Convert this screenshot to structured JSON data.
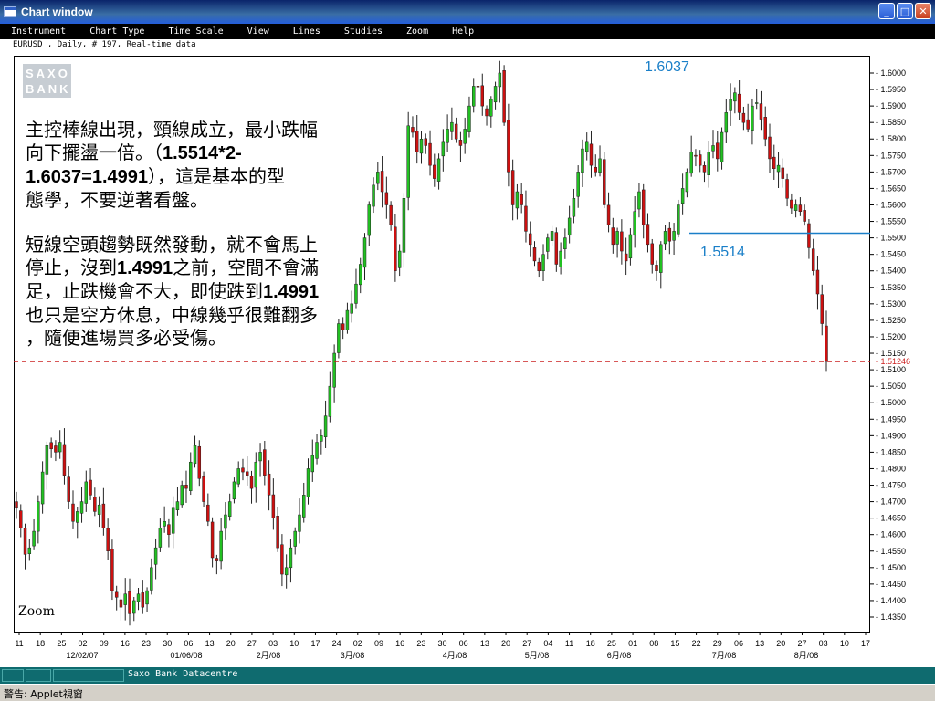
{
  "window": {
    "title": "Chart window",
    "minimize": "_",
    "maximize": "□",
    "close": "✕"
  },
  "menu": [
    "Instrument",
    "Chart Type",
    "Time Scale",
    "View",
    "Lines",
    "Studies",
    "Zoom",
    "Help"
  ],
  "subheader": "EURUSD , Daily, # 197, Real-time data",
  "logo": {
    "line1": "SAXO",
    "line2": "BANK"
  },
  "annotation": {
    "paragraph1": [
      "主控棒線出現，頸線成立，最小跌幅",
      "向下擺盪一倍。（",
      "1.5514*2-",
      "1.6037=1.4991",
      "），這是基本的型",
      "態學，不要逆著看盤。"
    ],
    "paragraph2": [
      "短線空頭趨勢既然發動，就不會馬上",
      "停止，沒到",
      "1.4991",
      "之前，空間不會滿",
      "足，止跌機會不大，即使跌到",
      "1.4991",
      "也只是空方休息，中線幾乎很難翻多",
      "，隨便進場買多必受傷。"
    ]
  },
  "zoom_label": "Zoom",
  "status": {
    "source": "Saxo Bank Datacentre"
  },
  "warning": "警告: Applet視窗",
  "chart_data": {
    "type": "candlestick",
    "instrument": "EURUSD",
    "interval": "Daily",
    "ylim": [
      1.43,
      1.6
    ],
    "y_ticks": [
      "1.6000",
      "1.5950",
      "1.5900",
      "1.5850",
      "1.5800",
      "1.5750",
      "1.5700",
      "1.5650",
      "1.5600",
      "1.5550",
      "1.5500",
      "1.5450",
      "1.5400",
      "1.5350",
      "1.5300",
      "1.5250",
      "1.5200",
      "1.5150",
      "1.5100",
      "1.5050",
      "1.5000",
      "1.4950",
      "1.4900",
      "1.4850",
      "1.4800",
      "1.4750",
      "1.4700",
      "1.4650",
      "1.4600",
      "1.4550",
      "1.4500",
      "1.4450",
      "1.4400",
      "1.4350"
    ],
    "x_ticks": [
      "11",
      "18",
      "25",
      "02",
      "09",
      "16",
      "23",
      "30",
      "06",
      "13",
      "20",
      "27",
      "03",
      "10",
      "17",
      "24",
      "02",
      "09",
      "16",
      "23",
      "30",
      "06",
      "13",
      "20",
      "27",
      "04",
      "11",
      "18",
      "25",
      "01",
      "08",
      "15",
      "22",
      "29",
      "06",
      "13",
      "20",
      "27",
      "03",
      "10",
      "17"
    ],
    "month_labels": [
      "12/02/07",
      "01/06/08",
      "2月/08",
      "3月/08",
      "4月/08",
      "5月/08",
      "6月/08",
      "7月/08",
      "8月/08"
    ],
    "annotations": {
      "high": "1.6037",
      "neckline": "1.5514",
      "current": "1.51246"
    },
    "colors": {
      "up": "#22c022",
      "down": "#cc1010",
      "neckline": "#1a7fc8",
      "current_line": "#cc2020"
    },
    "closes": [
      1.468,
      1.462,
      1.454,
      1.456,
      1.461,
      1.47,
      1.479,
      1.487,
      1.486,
      1.485,
      1.488,
      1.478,
      1.47,
      1.464,
      1.467,
      1.47,
      1.476,
      1.472,
      1.467,
      1.469,
      1.462,
      1.455,
      1.443,
      1.441,
      1.438,
      1.442,
      1.436,
      1.44,
      1.442,
      1.438,
      1.443,
      1.45,
      1.456,
      1.462,
      1.464,
      1.46,
      1.468,
      1.47,
      1.475,
      1.474,
      1.482,
      1.487,
      1.477,
      1.47,
      1.464,
      1.453,
      1.452,
      1.461,
      1.466,
      1.47,
      1.476,
      1.48,
      1.479,
      1.478,
      1.474,
      1.482,
      1.485,
      1.478,
      1.472,
      1.465,
      1.456,
      1.448,
      1.45,
      1.456,
      1.461,
      1.466,
      1.472,
      1.48,
      1.484,
      1.488,
      1.49,
      1.496,
      1.505,
      1.515,
      1.524,
      1.522,
      1.528,
      1.53,
      1.536,
      1.542,
      1.55,
      1.56,
      1.566,
      1.57,
      1.564,
      1.56,
      1.554,
      1.54,
      1.546,
      1.562,
      1.584,
      1.582,
      1.576,
      1.58,
      1.578,
      1.572,
      1.568,
      1.574,
      1.579,
      1.583,
      1.585,
      1.58,
      1.578,
      1.583,
      1.59,
      1.596,
      1.596,
      1.59,
      1.587,
      1.592,
      1.596,
      1.6,
      1.585,
      1.57,
      1.56,
      1.564,
      1.56,
      1.552,
      1.548,
      1.543,
      1.54,
      1.545,
      1.55,
      1.552,
      1.542,
      1.546,
      1.55,
      1.556,
      1.562,
      1.57,
      1.577,
      1.579,
      1.572,
      1.57,
      1.574,
      1.56,
      1.554,
      1.548,
      1.552,
      1.546,
      1.543,
      1.551,
      1.558,
      1.564,
      1.554,
      1.548,
      1.542,
      1.54,
      1.548,
      1.552,
      1.549,
      1.552,
      1.56,
      1.565,
      1.57,
      1.576,
      1.575,
      1.572,
      1.57,
      1.576,
      1.578,
      1.574,
      1.582,
      1.588,
      1.592,
      1.594,
      1.588,
      1.585,
      1.583,
      1.59,
      1.591,
      1.586,
      1.58,
      1.574,
      1.571,
      1.572,
      1.568,
      1.562,
      1.559,
      1.56,
      1.558,
      1.555,
      1.547,
      1.54,
      1.533,
      1.524,
      1.5125
    ]
  }
}
